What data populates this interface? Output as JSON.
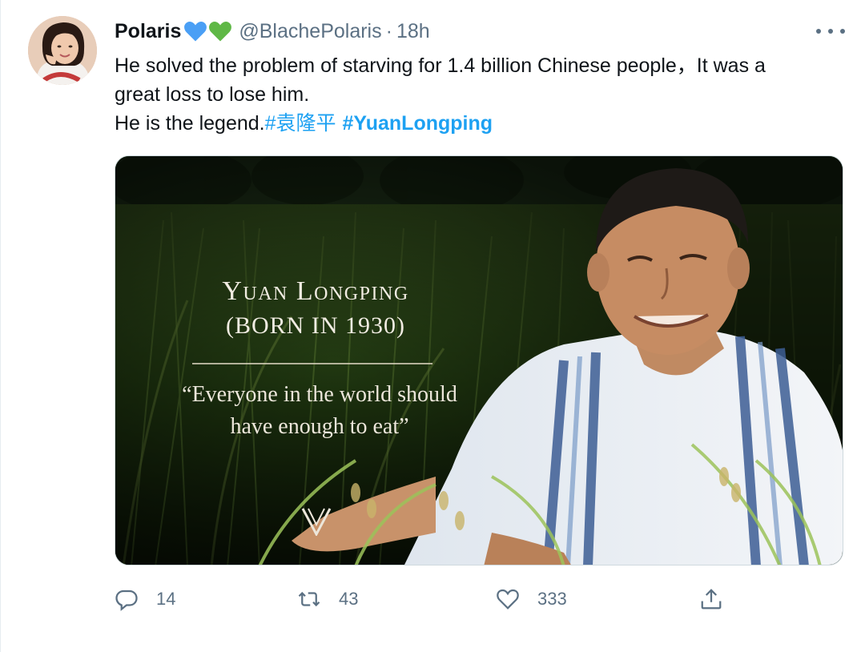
{
  "tweet": {
    "display_name": "Polaris",
    "name_emoji": [
      "blue-heart-icon",
      "green-heart-icon"
    ],
    "handle": "@BlachePolaris",
    "separator": "·",
    "time": "18h",
    "more_icon": "more-icon",
    "text": {
      "line1": "He solved the problem of starving for 1.4 billion Chinese people，It was a",
      "line2": "great loss to lose him.",
      "line3_prefix": "He is the legend.",
      "hashtag1": "#袁隆平",
      "hashtag2": "#YuanLongping"
    },
    "image": {
      "title": "Yuan Longping",
      "subtitle": "(BORN IN 1930)",
      "quote_line1": "“Everyone in the world should",
      "quote_line2": "have enough to eat”",
      "logo_icon": "v-logo-icon"
    },
    "actions": {
      "reply_count": "14",
      "retweet_count": "43",
      "like_count": "333",
      "reply_icon": "reply-icon",
      "retweet_icon": "retweet-icon",
      "like_icon": "heart-icon",
      "share_icon": "share-icon"
    },
    "colors": {
      "link": "#1da1f2",
      "secondary_text": "#5b7083",
      "blue_heart": "#4a9ff5",
      "green_heart": "#5fb846"
    }
  }
}
